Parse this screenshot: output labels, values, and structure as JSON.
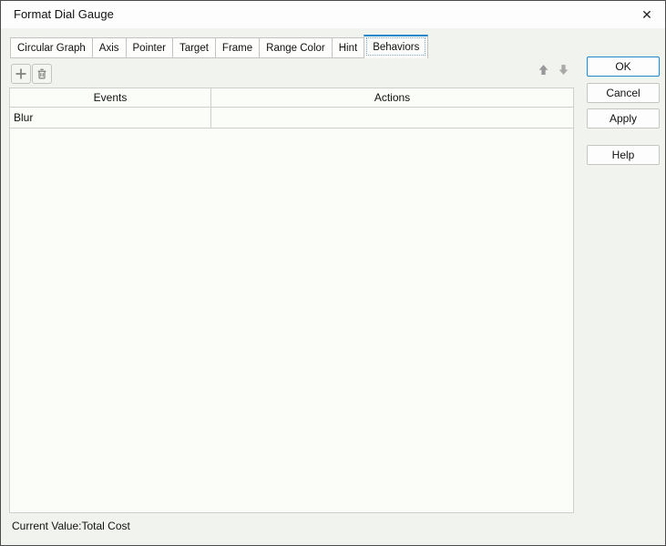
{
  "window": {
    "title": "Format Dial Gauge"
  },
  "icons": {
    "close": "✕",
    "add": "plus",
    "delete": "trash",
    "move_up": "arrow-up",
    "move_down": "arrow-down"
  },
  "tabs": [
    {
      "label": "Circular Graph",
      "active": false
    },
    {
      "label": "Axis",
      "active": false
    },
    {
      "label": "Pointer",
      "active": false
    },
    {
      "label": "Target",
      "active": false
    },
    {
      "label": "Frame",
      "active": false
    },
    {
      "label": "Range Color",
      "active": false
    },
    {
      "label": "Hint",
      "active": false
    },
    {
      "label": "Behaviors",
      "active": true
    }
  ],
  "table": {
    "columns": [
      "Events",
      "Actions"
    ],
    "rows": [
      {
        "event": "Blur",
        "action": ""
      }
    ]
  },
  "status_bar": {
    "text": "Current Value:Total Cost"
  },
  "action_buttons": {
    "ok": "OK",
    "cancel": "Cancel",
    "apply": "Apply",
    "help": "Help"
  },
  "colors": {
    "accent": "#1987c8",
    "ok_border": "#2387c8",
    "dialog_bg": "#f1f3ef",
    "titlebar_bg": "#fdfdfd",
    "table_bg": "#fbfdf9",
    "grid_border": "#cfcfcd",
    "control_border": "#c3c3c1",
    "icon_gray": "#828280",
    "arrow_gray": "#9e9e9c",
    "window_border": "#4b4b4b"
  }
}
